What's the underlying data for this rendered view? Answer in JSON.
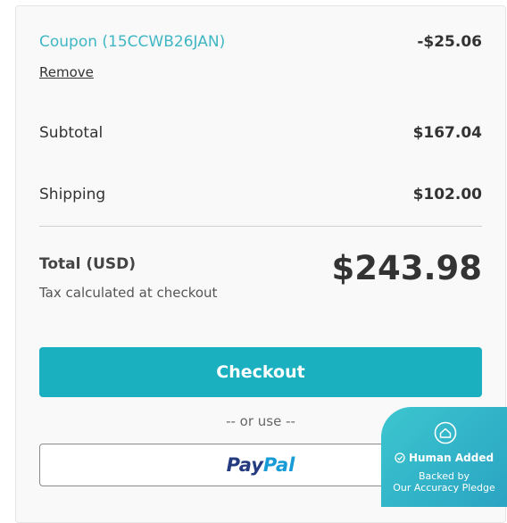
{
  "coupon": {
    "label": "Coupon (15CCWB26JAN)",
    "amount": "-$25.06",
    "remove_label": "Remove"
  },
  "summary": {
    "subtotal_label": "Subtotal",
    "subtotal_value": "$167.04",
    "shipping_label": "Shipping",
    "shipping_value": "$102.00",
    "total_label": "Total (USD)",
    "total_value": "$243.98",
    "tax_note": "Tax calculated at checkout"
  },
  "actions": {
    "checkout_label": "Checkout",
    "or_use": "-- or use --",
    "paypal_a": "Pay",
    "paypal_b": "Pal"
  },
  "badge": {
    "title": "Human Added",
    "line1": "Backed by",
    "line2": "Our Accuracy Pledge"
  },
  "colors": {
    "accent": "#1bb0bf",
    "coupon": "#3fb6c3",
    "paypal_dark": "#253b80",
    "paypal_light": "#179bd7"
  }
}
